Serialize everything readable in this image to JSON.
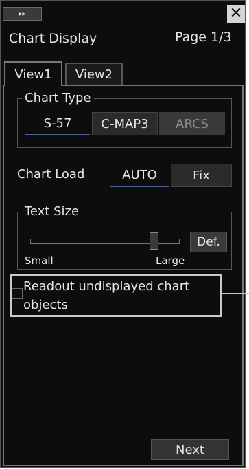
{
  "window": {
    "collapse_glyph": "▸▸",
    "close_glyph": "✕",
    "title": "Chart Display",
    "page_indicator": "Page 1/3"
  },
  "tabs": [
    {
      "label": "View1",
      "selected": true
    },
    {
      "label": "View2",
      "selected": false
    }
  ],
  "chart_type": {
    "legend": "Chart Type",
    "options": [
      {
        "label": "S-57",
        "state": "selected"
      },
      {
        "label": "C-MAP3",
        "state": "normal"
      },
      {
        "label": "ARCS",
        "state": "disabled"
      }
    ]
  },
  "chart_load": {
    "label": "Chart Load",
    "options": [
      {
        "label": "AUTO",
        "state": "selected"
      },
      {
        "label": "Fix",
        "state": "normal"
      }
    ]
  },
  "text_size": {
    "legend": "Text Size",
    "min_label": "Small",
    "max_label": "Large",
    "level": 0.85,
    "default_label": "Def."
  },
  "readout": {
    "label": "Readout undisplayed chart objects",
    "checked": false
  },
  "footer": {
    "next_label": "Next"
  },
  "colors": {
    "background": "#0d0d0d",
    "accent": "#3b63c4",
    "highlight_frame": "#c9c9c9"
  }
}
